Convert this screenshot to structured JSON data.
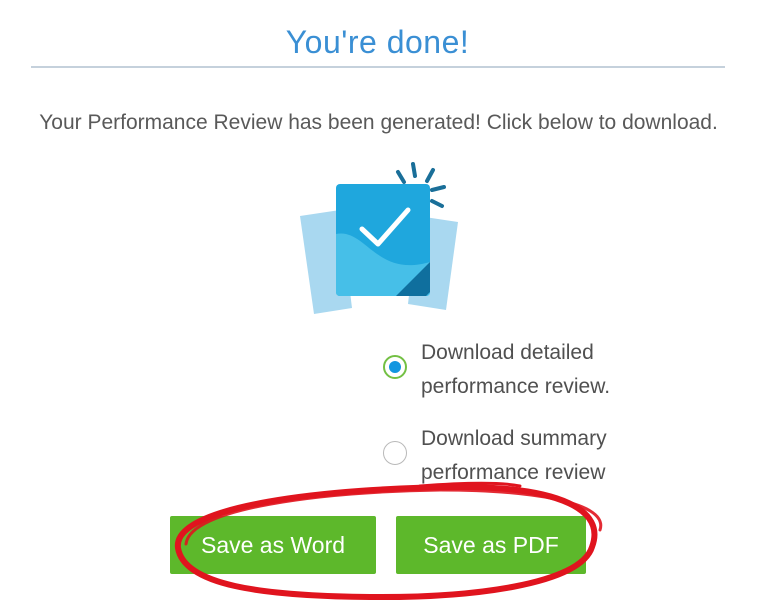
{
  "header": {
    "title": "You're done!"
  },
  "message": "Your Performance Review has been generated! Click below to download.",
  "download_options": [
    {
      "label_line1": "Download detailed",
      "label_line2": "performance review.",
      "selected": true
    },
    {
      "label_line1": "Download summary",
      "label_line2": "performance review",
      "selected": false
    }
  ],
  "actions": {
    "save_word_label": "Save as Word",
    "save_pdf_label": "Save as PDF"
  },
  "colors": {
    "title": "#3a8fd4",
    "button_green": "#5db82b",
    "radio_selected": "#1296e0",
    "annotation_red": "#e0141e"
  },
  "icons": {
    "illustration": "document-check-icon"
  }
}
